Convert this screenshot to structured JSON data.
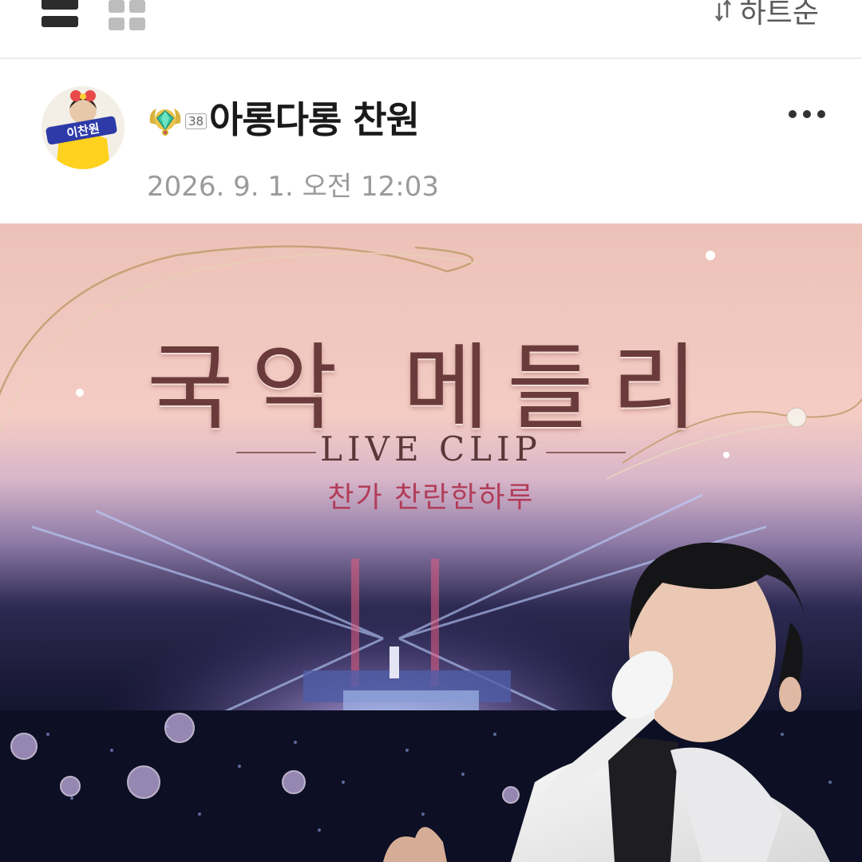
{
  "toolbar": {
    "list_view_icon": "list-view-icon",
    "grid_view_icon": "grid-view-icon",
    "sort_icon": "sort-arrows-icon",
    "sort_label": "하트순"
  },
  "post": {
    "author_name": "아롱다롱 찬원",
    "level_badge_icon": "gem-medal-icon",
    "level": "38",
    "date": "2026. 9. 1. 오전 12:03",
    "more_icon": "more-dots-icon",
    "avatar_text": "이찬원"
  },
  "hero": {
    "title": "국악 메들리",
    "subtitle": "LIVE CLIP",
    "caption": "찬가 찬란한하루"
  },
  "colors": {
    "accent": "#b23d5a",
    "title_brown": "#6b3b3b",
    "muted_text": "#9a9a9a"
  }
}
